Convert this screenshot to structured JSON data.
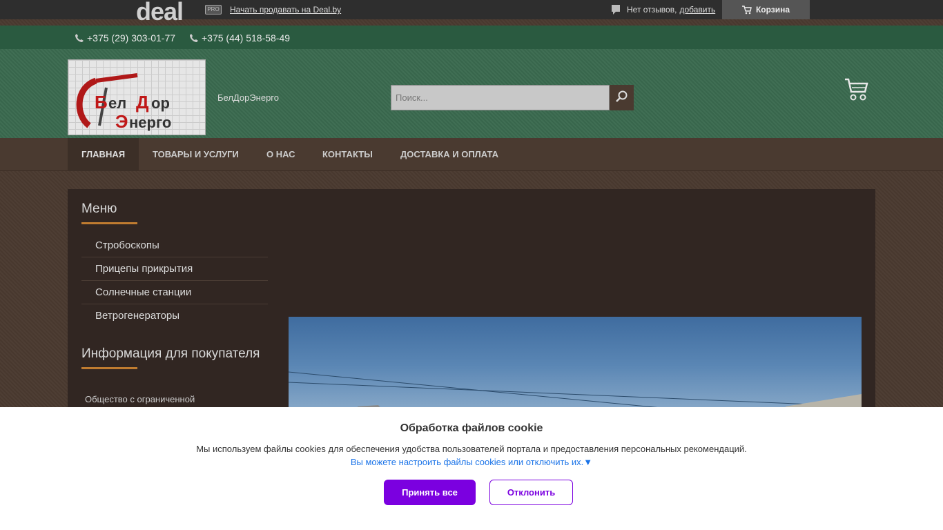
{
  "topbar": {
    "logo_text": "deal",
    "pro_badge": "PRO",
    "sell_link": "Начать продавать на Deal.by",
    "reviews_text": "Нет отзывов,",
    "reviews_add": "добавить",
    "cart_label": "Корзина"
  },
  "phones": [
    "+375 (29) 303-01-77",
    "+375 (44) 518-58-49"
  ],
  "header": {
    "brand_name": "БелДорЭнерго",
    "search_placeholder": "Поиск..."
  },
  "nav": {
    "items": [
      "Главная",
      "Товары и услуги",
      "О нас",
      "Контакты",
      "Доставка и оплата"
    ],
    "active": "Главная"
  },
  "sidebar": {
    "menu_title": "Меню",
    "menu_items": [
      "Стробоскопы",
      "Прицепы прикрытия",
      "Солнечные станции",
      "Ветрогенераторы"
    ],
    "info_title": "Информация для покупателя",
    "info_text": "Общество с ограниченной"
  },
  "cookie": {
    "title": "Обработка файлов cookie",
    "text": "Мы используем файлы cookies для обеспечения удобства пользователей портала и предоставления персональных рекомендаций.",
    "link": "Вы можете настроить файлы cookies или отключить их.▼",
    "accept": "Принять все",
    "decline": "Отклонить"
  },
  "colors": {
    "accent": "#7b00e0",
    "header_green": "#3a6a4f",
    "nav_brown": "#4a3a30",
    "underline": "#c07c30"
  }
}
